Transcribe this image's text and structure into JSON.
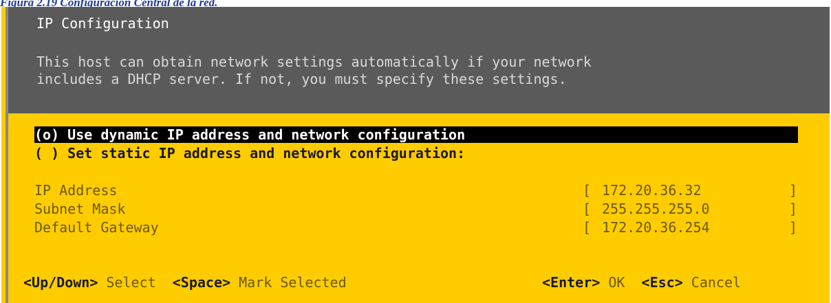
{
  "caption": "Figura 2.19 Configuración Central de la red.",
  "screen": {
    "title": "IP Configuration",
    "description_line1": "This host can obtain network settings automatically if your network",
    "description_line2": "includes a DHCP server. If not, you must specify these settings."
  },
  "options": [
    {
      "label": "(o) Use dynamic IP address and network configuration",
      "selected": true
    },
    {
      "label": "( ) Set static IP address and network configuration:",
      "selected": false
    }
  ],
  "fields": [
    {
      "label": "IP Address",
      "value": "172.20.36.32"
    },
    {
      "label": "Subnet Mask",
      "value": "255.255.255.0"
    },
    {
      "label": "Default Gateway",
      "value": "172.20.36.254"
    }
  ],
  "bracket_open": "[",
  "bracket_close": "]",
  "footer": {
    "key1": "<Up/Down>",
    "action1": "Select",
    "key2": "<Space>",
    "action2": "Mark Selected",
    "key3": "<Enter>",
    "action3": "OK",
    "key4": "<Esc>",
    "action4": "Cancel"
  },
  "colors": {
    "background": "#ffcc00",
    "header": "#5a5a5a",
    "selection": "#000000",
    "caption": "#1f3a93"
  }
}
